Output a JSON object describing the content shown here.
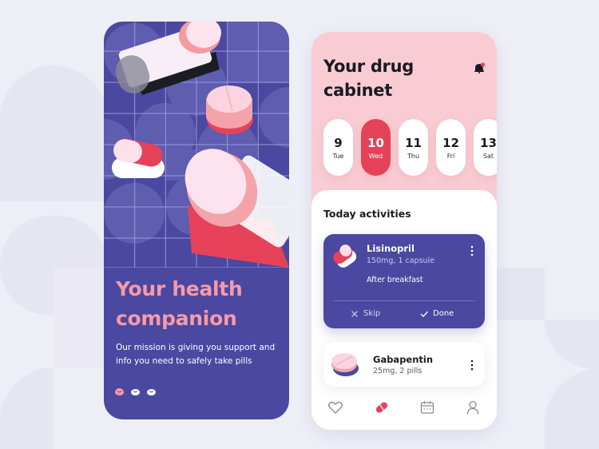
{
  "left_screen": {
    "headline": "Your health companion",
    "headline_line1": "Your health",
    "headline_line2": "companion",
    "description": "Our mission is giving you support and info you need to safely take pills",
    "page_indicators": [
      {
        "state": "active",
        "color": "#f79aa8"
      },
      {
        "state": "inactive",
        "color": "#ffffff"
      },
      {
        "state": "inactive",
        "color": "#ffffff"
      }
    ],
    "illustration": "pill-bottles-and-capsules"
  },
  "right_screen": {
    "title_line1": "Your drug",
    "title_line2": "cabinet",
    "notification_icon": "bell-icon",
    "days": [
      {
        "num": "9",
        "name": "Tue",
        "selected": false
      },
      {
        "num": "10",
        "name": "Wed",
        "selected": true
      },
      {
        "num": "11",
        "name": "Thu",
        "selected": false
      },
      {
        "num": "12",
        "name": "Fri",
        "selected": false
      },
      {
        "num": "13",
        "name": "Sat",
        "selected": false
      }
    ],
    "section_title": "Today activities",
    "medications": [
      {
        "name": "Lisinopril",
        "dose": "150mg, 1 capsule",
        "note": "After breakfast",
        "icon": "capsule-icon",
        "actions": {
          "skip": "Skip",
          "done": "Done"
        }
      },
      {
        "name": "Gabapentin",
        "dose": "25mg, 2 pills",
        "icon": "tablet-icon"
      }
    ],
    "bottom_nav": [
      {
        "icon": "heart-icon",
        "active": false
      },
      {
        "icon": "pill-icon",
        "active": true
      },
      {
        "icon": "calendar-icon",
        "active": false
      },
      {
        "icon": "profile-icon",
        "active": false
      }
    ]
  },
  "colors": {
    "primary": "#4a48a0",
    "accent": "#e5425a",
    "pink_light": "#f8ccd2",
    "headline_pink": "#f79aa8",
    "background": "#eeeef7"
  }
}
